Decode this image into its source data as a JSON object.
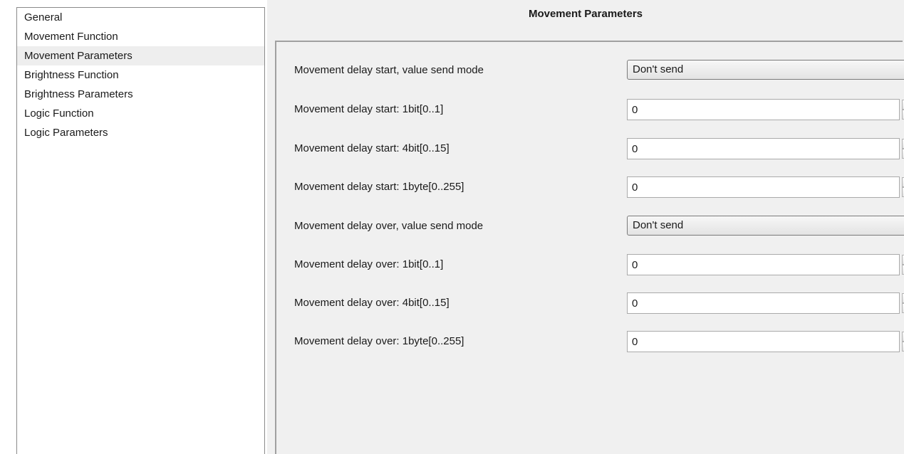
{
  "nav": {
    "items": [
      {
        "label": "General"
      },
      {
        "label": "Movement Function"
      },
      {
        "label": "Movement Parameters",
        "selected": true
      },
      {
        "label": "Brightness Function"
      },
      {
        "label": "Brightness Parameters"
      },
      {
        "label": "Logic Function"
      },
      {
        "label": "Logic Parameters"
      }
    ]
  },
  "pane": {
    "title": "Movement Parameters",
    "rows": [
      {
        "label": "Movement delay start, value send mode",
        "type": "dropdown",
        "value": "Don't send"
      },
      {
        "label": "Movement delay start: 1bit[0..1]",
        "type": "spin",
        "value": "0"
      },
      {
        "label": "Movement delay start: 4bit[0..15]",
        "type": "spin",
        "value": "0"
      },
      {
        "label": "Movement delay start: 1byte[0..255]",
        "type": "spin",
        "value": "0"
      },
      {
        "label": "Movement delay over, value send mode",
        "type": "dropdown",
        "value": "Don't send"
      },
      {
        "label": "Movement delay over: 1bit[0..1]",
        "type": "spin",
        "value": "0"
      },
      {
        "label": "Movement delay over: 4bit[0..15]",
        "type": "spin",
        "value": "0"
      },
      {
        "label": "Movement delay over: 1byte[0..255]",
        "type": "spin",
        "value": "0"
      }
    ]
  },
  "icons": {
    "dropdown_arrow": "chevron-down-icon",
    "spin_up": "spin-up-icon",
    "spin_down": "spin-down-icon"
  },
  "colors": {
    "pane_background": "#f0f0f0",
    "selected_item_background": "#eeeeee",
    "border": "#8a8a8a"
  }
}
